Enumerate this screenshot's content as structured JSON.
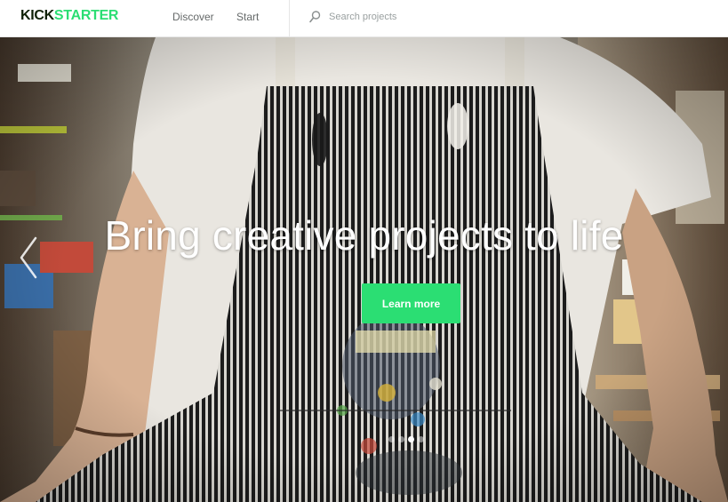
{
  "header": {
    "logo_part1": "KICK",
    "logo_part2": "STARTER",
    "nav": [
      {
        "label": "Discover"
      },
      {
        "label": "Start"
      }
    ],
    "search": {
      "placeholder": "Search projects",
      "icon": "search-icon"
    }
  },
  "hero": {
    "headline": "Bring creative projects to life",
    "cta_label": "Learn more",
    "prev_icon": "chevron-left-icon",
    "slides": {
      "count": 4,
      "active_index": 2
    }
  },
  "colors": {
    "brand_green": "#2bde73",
    "brand_dark": "#0f2105",
    "nav_text": "#656969",
    "placeholder_text": "#9aa0a0"
  }
}
